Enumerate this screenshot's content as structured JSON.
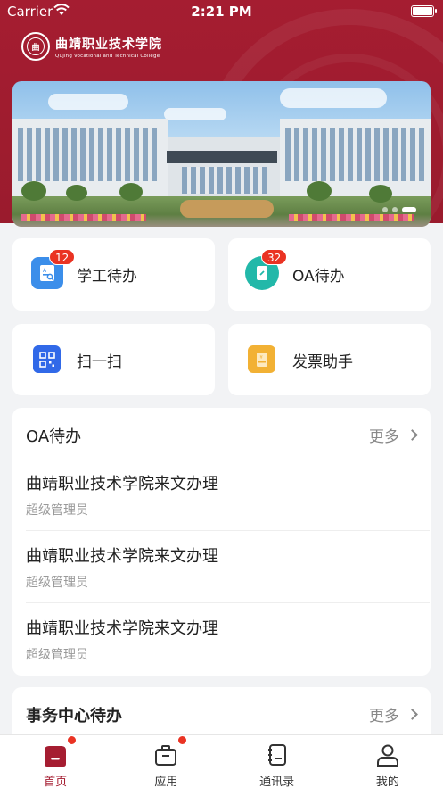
{
  "status_bar": {
    "carrier": "Carrier",
    "time": "2:21 PM"
  },
  "header": {
    "logo_cn": "曲靖职业技术学院",
    "logo_en": "Qujing Vocational and Technical College",
    "seal_text": "曲"
  },
  "banner": {
    "slide_count": 3,
    "active_index": 2
  },
  "quick_actions": [
    {
      "label": "学工待办",
      "badge": "12",
      "icon": "student-affairs-icon",
      "color": "#3b8eea"
    },
    {
      "label": "OA待办",
      "badge": "32",
      "icon": "oa-document-icon",
      "color": "#22b8a9"
    },
    {
      "label": "扫一扫",
      "icon": "qr-scan-icon",
      "color": "#3169e8"
    },
    {
      "label": "发票助手",
      "icon": "invoice-icon",
      "color": "#f2b134"
    }
  ],
  "oa_section": {
    "title": "OA待办",
    "more": "更多",
    "items": [
      {
        "title": "曲靖职业技术学院来文办理",
        "subtitle": "超级管理员"
      },
      {
        "title": "曲靖职业技术学院来文办理",
        "subtitle": "超级管理员"
      },
      {
        "title": "曲靖职业技术学院来文办理",
        "subtitle": "超级管理员"
      }
    ]
  },
  "affairs_section": {
    "title": "事务中心待办",
    "more": "更多"
  },
  "tabbar": [
    {
      "label": "首页",
      "icon": "home-icon",
      "active": true,
      "dot": true
    },
    {
      "label": "应用",
      "icon": "briefcase-icon",
      "active": false,
      "dot": true
    },
    {
      "label": "通讯录",
      "icon": "contacts-icon",
      "active": false,
      "dot": false
    },
    {
      "label": "我的",
      "icon": "profile-icon",
      "active": false,
      "dot": false
    }
  ],
  "colors": {
    "brand": "#a51d31",
    "badge": "#ea3323",
    "background": "#f2f3f5"
  }
}
